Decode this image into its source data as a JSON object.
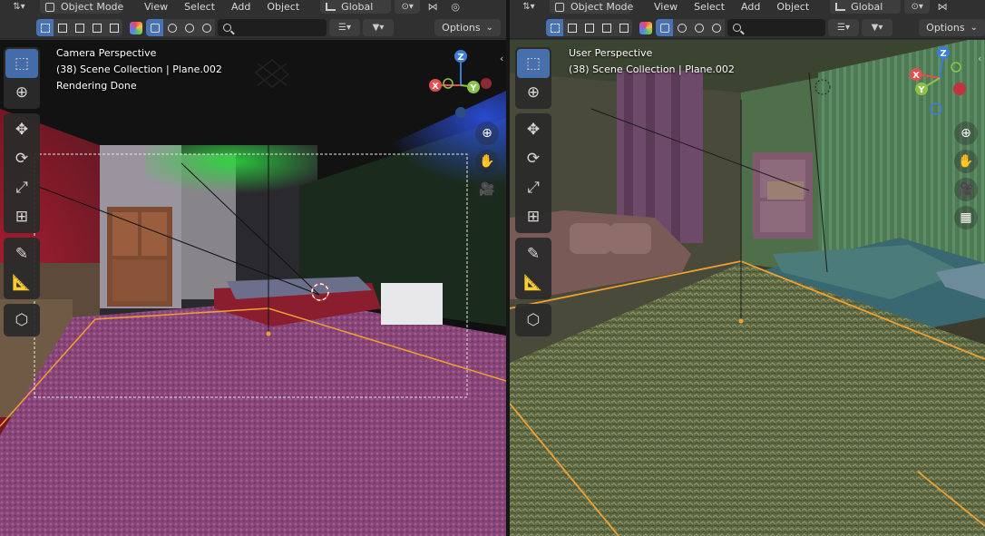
{
  "left_editor": {
    "mode": "Object Mode",
    "menu": [
      "View",
      "Select",
      "Add",
      "Object"
    ],
    "transform_orientation": "Global",
    "options_label": "Options",
    "overlay": {
      "line1": "Camera Perspective",
      "line2": "(38) Scene Collection | Plane.002",
      "line3": "Rendering Done"
    }
  },
  "right_editor": {
    "mode": "Object Mode",
    "menu": [
      "View",
      "Select",
      "Add",
      "Object"
    ],
    "transform_orientation": "Global",
    "options_label": "Options",
    "overlay": {
      "line1": "User Perspective",
      "line2": "(38) Scene Collection | Plane.002"
    }
  },
  "toolbar_tools": [
    {
      "name": "select-box",
      "icon": "select-box-icon"
    },
    {
      "name": "cursor",
      "icon": "cursor-icon"
    },
    {
      "name": "move",
      "icon": "move-icon"
    },
    {
      "name": "rotate",
      "icon": "rotate-icon"
    },
    {
      "name": "scale",
      "icon": "scale-icon"
    },
    {
      "name": "transform",
      "icon": "transform-icon"
    },
    {
      "name": "annotate",
      "icon": "annotate-icon"
    },
    {
      "name": "measure",
      "icon": "measure-icon"
    },
    {
      "name": "add-cube",
      "icon": "add-cube-icon"
    }
  ],
  "gizmo_axes": {
    "x": "X",
    "y": "Y",
    "z": "Z"
  },
  "colors": {
    "accent": "#4772b3",
    "header": "#303030",
    "axis_x": "#e84d4d",
    "axis_y": "#8bc34a",
    "axis_z": "#3b7dd8",
    "selection": "#f0a030"
  }
}
